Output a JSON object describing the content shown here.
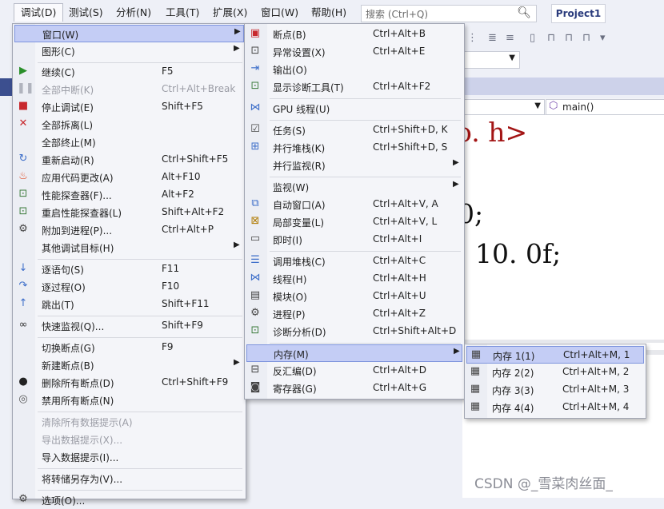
{
  "menubar": {
    "items": [
      {
        "label": "调试(D)"
      },
      {
        "label": "测试(S)"
      },
      {
        "label": "分析(N)"
      },
      {
        "label": "工具(T)"
      },
      {
        "label": "扩展(X)"
      },
      {
        "label": "窗口(W)"
      },
      {
        "label": "帮助(H)"
      }
    ],
    "search_placeholder": "搜索 (Ctrl+Q)",
    "project": "Project1"
  },
  "editor": {
    "function_dropdown": "main()",
    "code_lines": [
      "o. h>",
      "0;",
      "10. 0f;"
    ]
  },
  "debug_menu": {
    "items": [
      {
        "label": "窗口(W)",
        "shortcut": "",
        "submenu": true,
        "icon": "none",
        "highlighted": true
      },
      {
        "label": "图形(C)",
        "shortcut": "",
        "submenu": true,
        "icon": "none"
      },
      {
        "label": "继续(C)",
        "shortcut": "F5",
        "icon": "play-icon"
      },
      {
        "label": "全部中断(K)",
        "shortcut": "Ctrl+Alt+Break",
        "icon": "pause-icon",
        "disabled": true
      },
      {
        "label": "停止调试(E)",
        "shortcut": "Shift+F5",
        "icon": "stop-icon"
      },
      {
        "label": "全部拆离(L)",
        "shortcut": "",
        "icon": "detach-icon"
      },
      {
        "label": "全部终止(M)",
        "shortcut": "",
        "icon": "none"
      },
      {
        "label": "重新启动(R)",
        "shortcut": "Ctrl+Shift+F5",
        "icon": "restart-icon"
      },
      {
        "label": "应用代码更改(A)",
        "shortcut": "Alt+F10",
        "icon": "hot-reload-icon"
      },
      {
        "label": "性能探查器(F)...",
        "shortcut": "Alt+F2",
        "icon": "profiler-icon"
      },
      {
        "label": "重启性能探查器(L)",
        "shortcut": "Shift+Alt+F2",
        "icon": "profiler-restart-icon"
      },
      {
        "label": "附加到进程(P)...",
        "shortcut": "Ctrl+Alt+P",
        "icon": "attach-process-icon"
      },
      {
        "label": "其他调试目标(H)",
        "shortcut": "",
        "submenu": true,
        "icon": "none"
      },
      {
        "label": "逐语句(S)",
        "shortcut": "F11",
        "icon": "step-into-icon"
      },
      {
        "label": "逐过程(O)",
        "shortcut": "F10",
        "icon": "step-over-icon"
      },
      {
        "label": "跳出(T)",
        "shortcut": "Shift+F11",
        "icon": "step-out-icon"
      },
      {
        "label": "快速监视(Q)...",
        "shortcut": "Shift+F9",
        "icon": "quick-watch-icon"
      },
      {
        "label": "切换断点(G)",
        "shortcut": "F9",
        "icon": "none"
      },
      {
        "label": "新建断点(B)",
        "shortcut": "",
        "submenu": true,
        "icon": "none"
      },
      {
        "label": "删除所有断点(D)",
        "shortcut": "Ctrl+Shift+F9",
        "icon": "delete-breakpoints-icon"
      },
      {
        "label": "禁用所有断点(N)",
        "shortcut": "",
        "icon": "disable-breakpoints-icon"
      },
      {
        "label": "清除所有数据提示(A)",
        "shortcut": "",
        "icon": "none",
        "disabled": true
      },
      {
        "label": "导出数据提示(X)...",
        "shortcut": "",
        "icon": "none",
        "disabled": true
      },
      {
        "label": "导入数据提示(I)...",
        "shortcut": "",
        "icon": "none"
      },
      {
        "label": "将转储另存为(V)...",
        "shortcut": "",
        "icon": "none"
      },
      {
        "label": "选项(O)...",
        "shortcut": "",
        "icon": "options-icon"
      }
    ]
  },
  "window_submenu": {
    "items": [
      {
        "label": "断点(B)",
        "shortcut": "Ctrl+Alt+B",
        "icon": "breakpoints-window-icon"
      },
      {
        "label": "异常设置(X)",
        "shortcut": "Ctrl+Alt+E",
        "icon": "exception-settings-icon"
      },
      {
        "label": "输出(O)",
        "shortcut": "",
        "icon": "output-icon"
      },
      {
        "label": "显示诊断工具(T)",
        "shortcut": "Ctrl+Alt+F2",
        "icon": "diagnostic-tools-icon"
      },
      {
        "label": "GPU 线程(U)",
        "shortcut": "",
        "icon": "gpu-threads-icon"
      },
      {
        "label": "任务(S)",
        "shortcut": "Ctrl+Shift+D, K",
        "icon": "tasks-icon"
      },
      {
        "label": "并行堆栈(K)",
        "shortcut": "Ctrl+Shift+D, S",
        "icon": "parallel-stacks-icon"
      },
      {
        "label": "并行监视(R)",
        "shortcut": "",
        "submenu": true,
        "icon": "none"
      },
      {
        "label": "监视(W)",
        "shortcut": "",
        "submenu": true,
        "icon": "none"
      },
      {
        "label": "自动窗口(A)",
        "shortcut": "Ctrl+Alt+V, A",
        "icon": "autos-icon"
      },
      {
        "label": "局部变量(L)",
        "shortcut": "Ctrl+Alt+V, L",
        "icon": "locals-icon"
      },
      {
        "label": "即时(I)",
        "shortcut": "Ctrl+Alt+I",
        "icon": "immediate-icon"
      },
      {
        "label": "调用堆栈(C)",
        "shortcut": "Ctrl+Alt+C",
        "icon": "call-stack-icon"
      },
      {
        "label": "线程(H)",
        "shortcut": "Ctrl+Alt+H",
        "icon": "threads-icon"
      },
      {
        "label": "模块(O)",
        "shortcut": "Ctrl+Alt+U",
        "icon": "modules-icon"
      },
      {
        "label": "进程(P)",
        "shortcut": "Ctrl+Alt+Z",
        "icon": "processes-icon"
      },
      {
        "label": "诊断分析(D)",
        "shortcut": "Ctrl+Shift+Alt+D",
        "icon": "diagnostic-analysis-icon"
      },
      {
        "label": "内存(M)",
        "shortcut": "",
        "submenu": true,
        "icon": "none",
        "highlighted": true
      },
      {
        "label": "反汇编(D)",
        "shortcut": "Ctrl+Alt+D",
        "icon": "disassembly-icon"
      },
      {
        "label": "寄存器(G)",
        "shortcut": "Ctrl+Alt+G",
        "icon": "registers-icon"
      }
    ]
  },
  "memory_submenu": {
    "items": [
      {
        "label": "内存 1(1)",
        "shortcut": "Ctrl+Alt+M, 1",
        "highlighted": true
      },
      {
        "label": "内存 2(2)",
        "shortcut": "Ctrl+Alt+M, 2"
      },
      {
        "label": "内存 3(3)",
        "shortcut": "Ctrl+Alt+M, 3"
      },
      {
        "label": "内存 4(4)",
        "shortcut": "Ctrl+Alt+M, 4"
      }
    ]
  },
  "watermark": "CSDN @_雪菜肉丝面_",
  "colors": {
    "menu_highlight": "#c4cdf5",
    "highlight_border": "#7e94dd",
    "code_red": "#a31515"
  }
}
